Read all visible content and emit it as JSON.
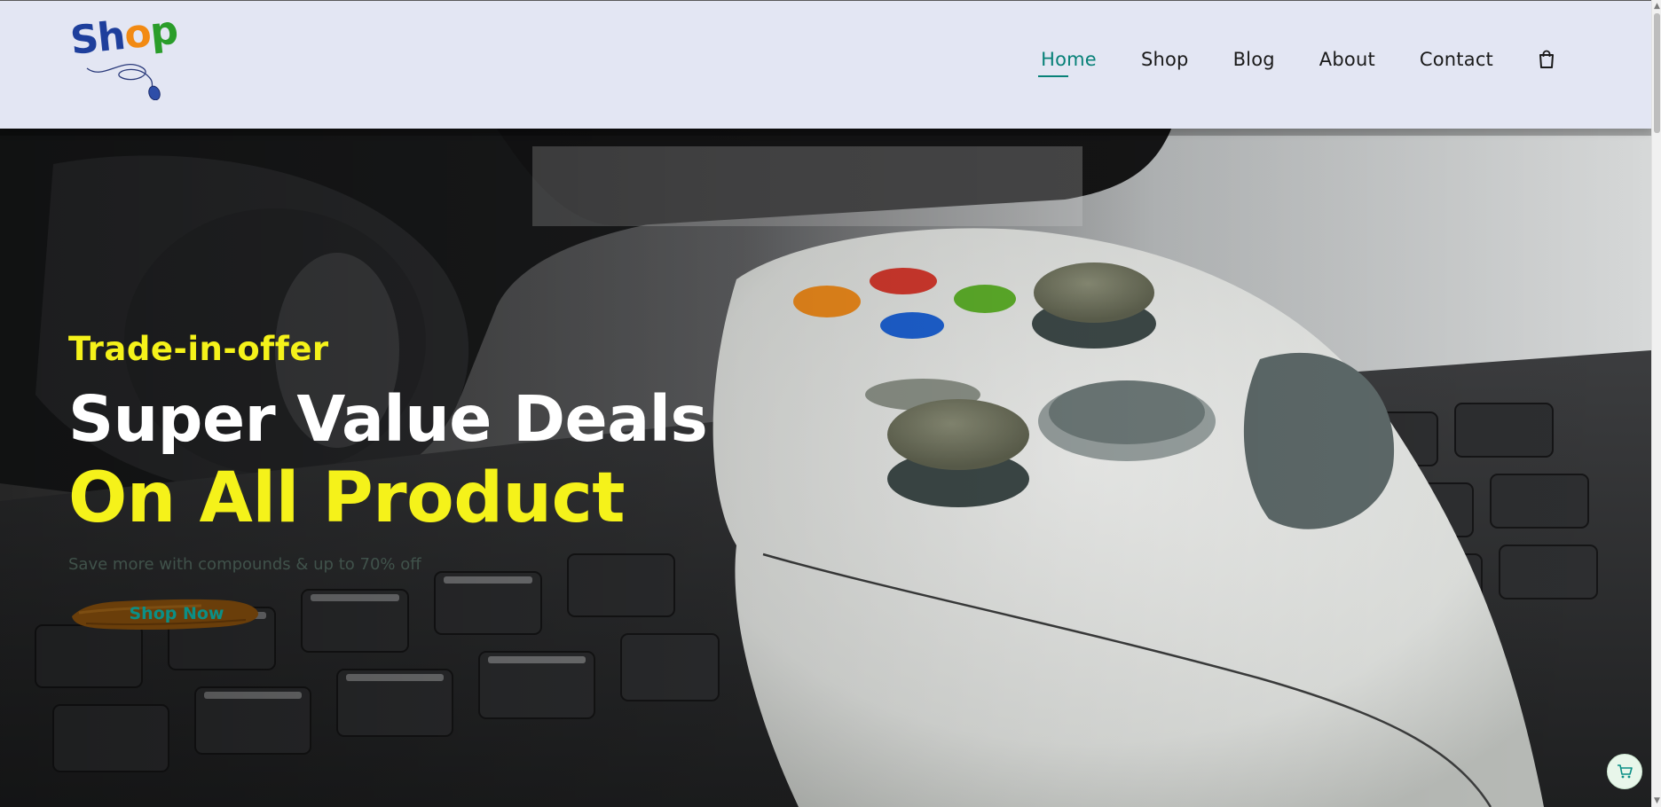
{
  "header": {
    "logo": {
      "letters": [
        "Sh",
        "o",
        "p"
      ],
      "colors": [
        "#1e3f9c",
        "#f28a13",
        "#2a9d2a"
      ]
    },
    "nav": [
      {
        "label": "Home",
        "active": true
      },
      {
        "label": "Shop",
        "active": false
      },
      {
        "label": "Blog",
        "active": false
      },
      {
        "label": "About",
        "active": false
      },
      {
        "label": "Contact",
        "active": false
      }
    ],
    "cart_icon": "shopping-bag-icon",
    "accent_color": "#088178",
    "background_color": "#e3e6f3"
  },
  "hero": {
    "background_image": "gaming-controller-on-keyboard-photo",
    "subhead": "Trade-in-offer",
    "headline_line1": "Super Value Deals",
    "headline_line2": "On All Product",
    "tagline": "Save more with compounds & up to 70% off",
    "button_label": "Shop Now",
    "highlight_color": "#f5f21a"
  },
  "floating_cart": {
    "icon": "shopping-cart-icon"
  }
}
